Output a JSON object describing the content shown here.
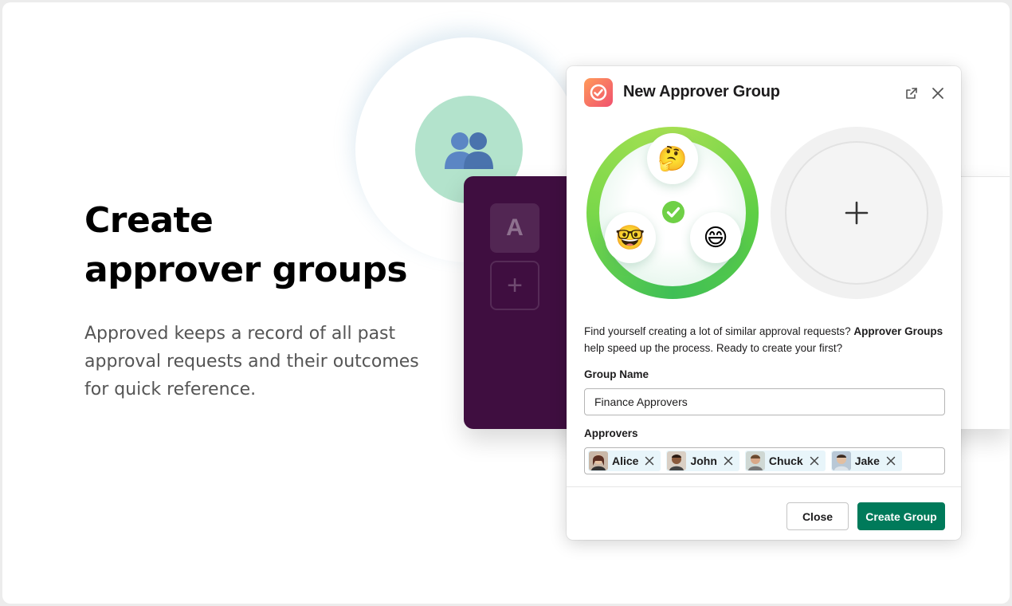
{
  "hero": {
    "title_line1": "Create",
    "title_line2": "approver groups",
    "description": "Approved keeps a record of all past approval requests and their outcomes for quick reference."
  },
  "sidebar": {
    "workspace_letter": "A",
    "add_label": "+"
  },
  "modal": {
    "title": "New Approver Group",
    "intro_prefix": "Find yourself creating a lot of similar approval requests? ",
    "intro_bold": "Approver Groups",
    "intro_suffix": " help speed up the process. Ready to create your first?",
    "group_name_label": "Group Name",
    "group_name_value": "Finance Approvers",
    "approvers_label": "Approvers",
    "approvers": [
      {
        "name": "Alice",
        "avatar_color": "#7a4a3a"
      },
      {
        "name": "John",
        "avatar_color": "#5a3a2a"
      },
      {
        "name": "Chuck",
        "avatar_color": "#8a6a50"
      },
      {
        "name": "Jake",
        "avatar_color": "#6a7a8a"
      }
    ],
    "close_button": "Close",
    "create_button": "Create Group",
    "illustration": {
      "emoji_top": "🤔",
      "emoji_left": "🤓",
      "emoji_right": "😄"
    }
  },
  "colors": {
    "purple": "#3f0e40",
    "primary": "#007a5a",
    "badge": "#b3e3cc",
    "ring": "#5fcf45"
  },
  "icons": [
    "group-icon",
    "app-check-icon",
    "popout-icon",
    "close-icon",
    "checkmark-icon",
    "plus-icon",
    "remove-icon"
  ]
}
